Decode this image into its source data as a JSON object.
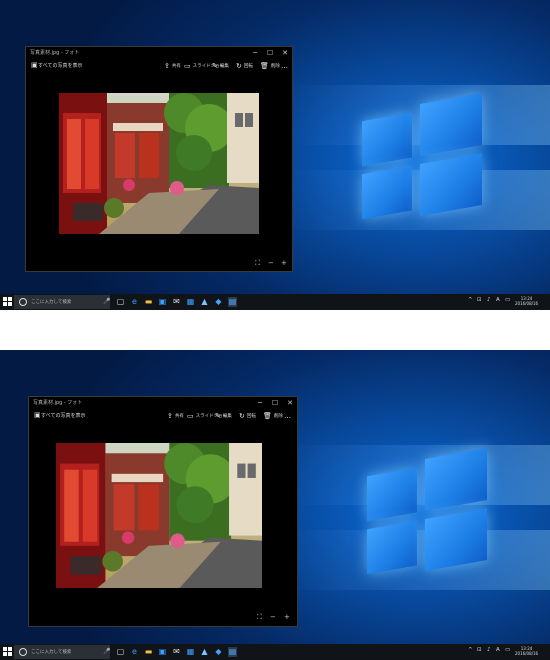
{
  "window": {
    "title": "写真素材.jpg - フォト",
    "view_all": "すべての写真を表示",
    "minimize": "─",
    "maximize": "☐",
    "close": "✕",
    "toolbar": [
      {
        "icon": "share-icon",
        "glyph": "⇪",
        "label": "共有"
      },
      {
        "icon": "slideshow-icon",
        "glyph": "▭",
        "label": "スライドショー"
      },
      {
        "icon": "edit-icon",
        "glyph": "✎",
        "label": "編集"
      },
      {
        "icon": "rotate-icon",
        "glyph": "↻",
        "label": "回転"
      },
      {
        "icon": "delete-icon",
        "glyph": "🗑",
        "label": "削除"
      },
      {
        "icon": "more-icon",
        "glyph": "…",
        "label": ""
      }
    ],
    "bottom": [
      {
        "icon": "fit-icon",
        "glyph": "⛶"
      },
      {
        "icon": "zoom-out-icon",
        "glyph": "−"
      },
      {
        "icon": "zoom-in-icon",
        "glyph": "+"
      }
    ]
  },
  "taskbar": {
    "search_placeholder": "ここに入力して検索",
    "clock_time": "13:24",
    "clock_date": "2016/08/16",
    "apps": [
      {
        "name": "task-view-icon",
        "glyph": "▢",
        "color": "#dddddd"
      },
      {
        "name": "edge-icon",
        "glyph": "e",
        "color": "#3aa0ff"
      },
      {
        "name": "explorer-icon",
        "glyph": "▬",
        "color": "#f0c040"
      },
      {
        "name": "store-icon",
        "glyph": "▣",
        "color": "#3aa0ff"
      },
      {
        "name": "mail-icon",
        "glyph": "✉",
        "color": "#dddddd"
      },
      {
        "name": "calendar-icon",
        "glyph": "▦",
        "color": "#3aa0ff"
      },
      {
        "name": "photos-icon",
        "glyph": "▲",
        "color": "#7cc4ff"
      },
      {
        "name": "app-icon-1",
        "glyph": "◆",
        "color": "#4aa0ff"
      },
      {
        "name": "app-icon-2",
        "glyph": "▤",
        "color": "#5ab0ff"
      }
    ],
    "tray": [
      {
        "name": "up-arrow-icon",
        "glyph": "^"
      },
      {
        "name": "network-icon",
        "glyph": "⊡"
      },
      {
        "name": "volume-icon",
        "glyph": "♪"
      },
      {
        "name": "ime-icon",
        "glyph": "A"
      },
      {
        "name": "notification-icon",
        "glyph": "▭"
      }
    ]
  }
}
